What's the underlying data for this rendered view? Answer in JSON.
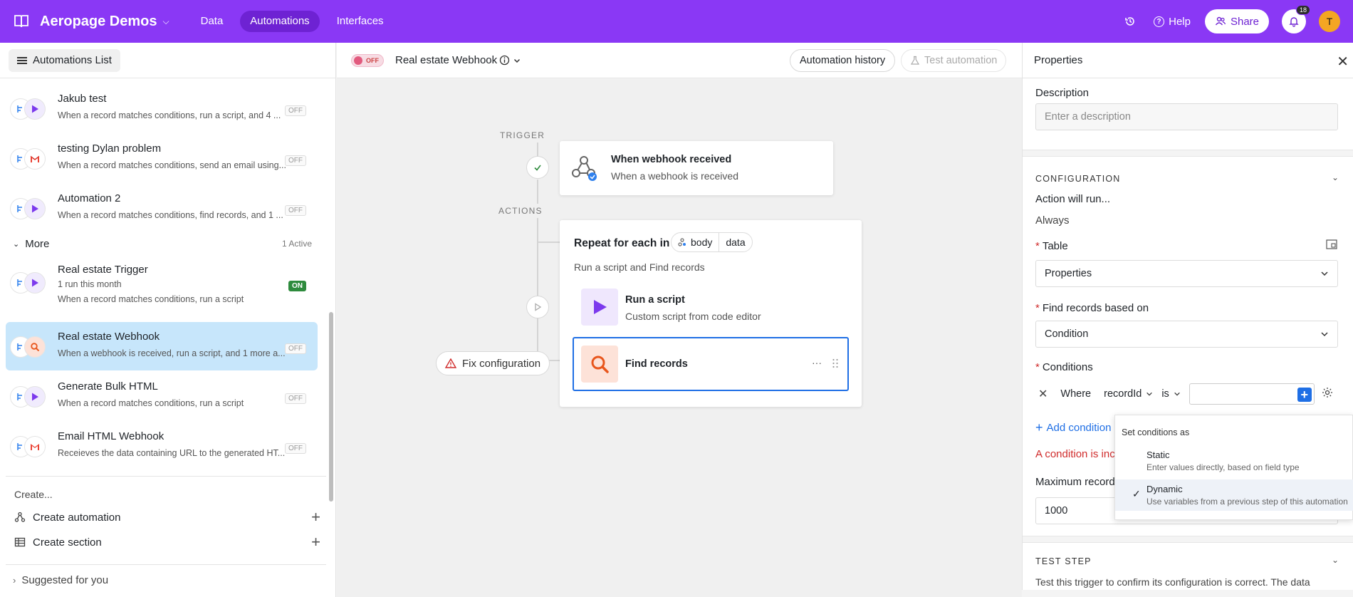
{
  "topbar": {
    "app_name": "Aeropage Demos",
    "nav": [
      "Data",
      "Automations",
      "Interfaces"
    ],
    "help_label": "Help",
    "share_label": "Share",
    "notifications_count": "18",
    "avatar_initial": "T",
    "colors": {
      "bar": "#8a38f5",
      "active_tab": "#6e22d3"
    }
  },
  "sidebar": {
    "list_button": "Automations List",
    "items": [
      {
        "title": "Jakub test",
        "sub": "When a record matches conditions, run a script, and 4 ...",
        "status": "OFF",
        "icon": "play-icon"
      },
      {
        "title": "testing Dylan problem",
        "sub": "When a record matches conditions, send an email using...",
        "status": "OFF",
        "icon": "gmail-icon"
      },
      {
        "title": "Automation 2",
        "sub": "When a record matches conditions, find records, and 1 ...",
        "status": "OFF",
        "icon": "play-icon"
      }
    ],
    "more": {
      "label": "More",
      "count": "1 Active"
    },
    "more_items": [
      {
        "title": "Real estate Trigger",
        "sub": "1 run this month",
        "sub2": "When a record matches conditions, run a script",
        "status": "ON",
        "icon": "play-icon"
      },
      {
        "title": "Real estate Webhook",
        "sub": "When a webhook is received, run a script, and 1 more a...",
        "status": "OFF",
        "icon": "search-icon"
      },
      {
        "title": "Generate Bulk HTML",
        "sub": "When a record matches conditions, run a script",
        "status": "OFF",
        "icon": "play-icon"
      },
      {
        "title": "Email HTML Webhook",
        "sub": "Receieves the data containing URL to the generated HT...",
        "status": "OFF",
        "icon": "gmail-icon"
      }
    ],
    "create_label": "Create...",
    "create_automation": "Create automation",
    "create_section": "Create section",
    "suggested": "Suggested for you"
  },
  "center": {
    "toggle_label": "OFF",
    "title": "Real estate Webhook",
    "history_btn": "Automation history",
    "test_btn": "Test automation",
    "trigger_label": "TRIGGER",
    "actions_label": "ACTIONS",
    "trigger_card": {
      "title": "When webhook received",
      "sub": "When a webhook is received"
    },
    "repeat_card": {
      "title": "Repeat for each in",
      "pill": [
        "body",
        "data"
      ],
      "sub": "Run a script and Find records"
    },
    "run_script": {
      "title": "Run a script",
      "sub": "Custom script from code editor"
    },
    "find_records": {
      "title": "Find records",
      "menu": "···"
    },
    "fix_btn": "Fix configuration"
  },
  "properties": {
    "title": "Properties",
    "description_label": "Description",
    "description_placeholder": "Enter a description",
    "configuration": "CONFIGURATION",
    "action_will_run": "Action will run...",
    "always": "Always",
    "table_label": "Table",
    "table_value": "Properties",
    "find_based_label": "Find records based on",
    "find_based_value": "Condition",
    "conditions_label": "Conditions",
    "where": "Where",
    "field": "recordId",
    "op": "is",
    "add_condition": "Add condition",
    "error": "A condition is inco",
    "max_records_label": "Maximum records",
    "max_records_value": "1000",
    "test_step": "TEST STEP",
    "test_step_desc": "Test this trigger to confirm its configuration is correct. The data"
  },
  "dropdown": {
    "header": "Set conditions as",
    "options": [
      {
        "title": "Static",
        "desc": "Enter values directly, based on field type"
      },
      {
        "title": "Dynamic",
        "desc": "Use variables from a previous step of this automation"
      }
    ]
  }
}
